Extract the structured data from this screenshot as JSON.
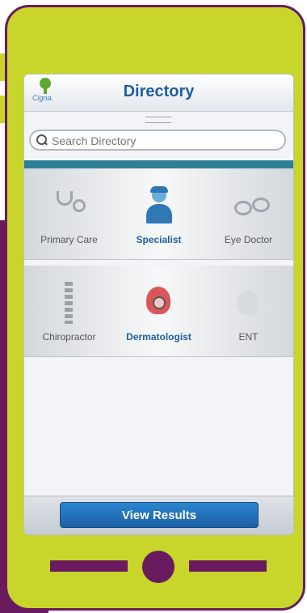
{
  "header": {
    "title": "Directory",
    "logo_text": "Cigna."
  },
  "search": {
    "placeholder": "Search Directory",
    "value": ""
  },
  "categories": [
    {
      "label": "Primary Care",
      "icon": "stethoscope-icon",
      "active": false
    },
    {
      "label": "Specialist",
      "icon": "doctor-icon",
      "active": true
    },
    {
      "label": "Eye Doctor",
      "icon": "eyeglasses-icon",
      "active": false
    },
    {
      "label": "Chiropractor",
      "icon": "spine-icon",
      "active": false
    },
    {
      "label": "Dermatologist",
      "icon": "skin-magnifier-icon",
      "active": true
    },
    {
      "label": "ENT",
      "icon": "ear-nose-throat-icon",
      "active": false
    }
  ],
  "footer": {
    "view_results_label": "View Results"
  },
  "colors": {
    "phone": "#c8d62b",
    "accent": "#6a1b5f",
    "brand": "#1f5ea3",
    "teal": "#2f7f95"
  }
}
